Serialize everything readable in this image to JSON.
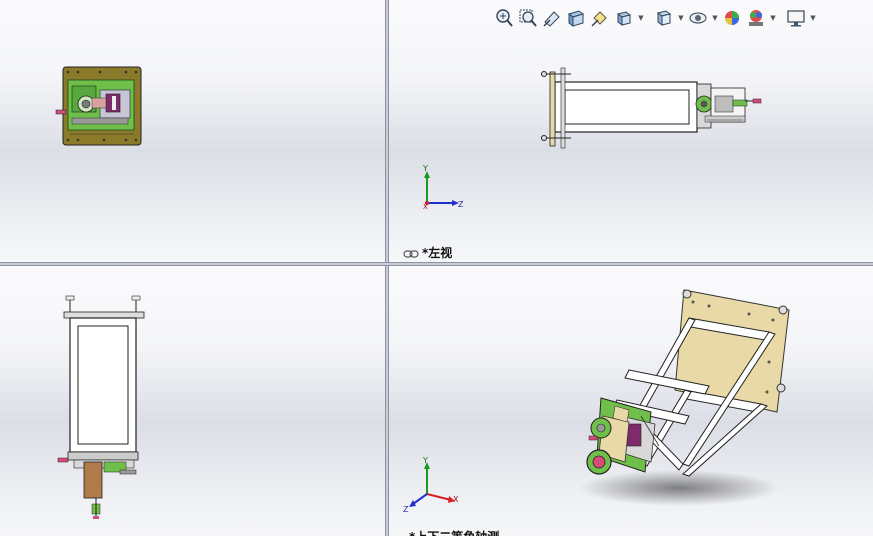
{
  "viewports": {
    "top_right": {
      "label": "*左视"
    },
    "bottom_right": {
      "label": "*上下二等角轴测"
    }
  },
  "axes": {
    "y": "Y",
    "x": "X",
    "z": "Z"
  },
  "toolbar": {
    "icons": [
      "zoom-to-fit-icon",
      "zoom-to-area-icon",
      "previous-view-icon",
      "section-view-icon",
      "dynamic-annotation-view-icon",
      "view-orientation-icon",
      "display-style-icon",
      "hide-show-items-icon",
      "edit-appearance-icon",
      "apply-scene-icon",
      "view-settings-icon"
    ]
  },
  "colors": {
    "viewport_border": "#8d93a3",
    "axis_y": "#1a9a1a",
    "axis_x": "#d42020",
    "axis_z": "#2030d0",
    "plate_olive": "#8a7a2a",
    "plate_tan": "#e8d9a6",
    "board_green": "#6fbf4a"
  }
}
